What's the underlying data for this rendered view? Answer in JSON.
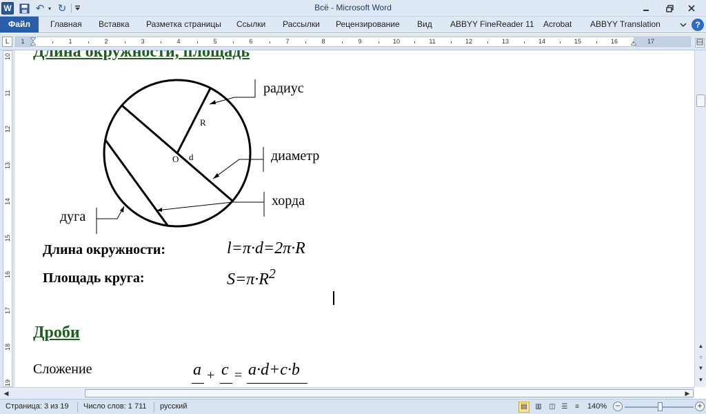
{
  "app": {
    "logo": "W",
    "title": "Всё  -  Microsoft Word"
  },
  "quick_access": {
    "undo_glyph": "↶",
    "redo_glyph": "↻",
    "dropdown_glyph": "▾"
  },
  "ribbon": {
    "tabs": [
      {
        "label": "Файл"
      },
      {
        "label": "Главная"
      },
      {
        "label": "Вставка"
      },
      {
        "label": "Разметка страницы"
      },
      {
        "label": "Ссылки"
      },
      {
        "label": "Рассылки"
      },
      {
        "label": "Рецензирование"
      },
      {
        "label": "Вид"
      },
      {
        "label": "ABBYY FineReader 11"
      },
      {
        "label": "Acrobat"
      },
      {
        "label": "ABBYY Translation"
      }
    ],
    "help_label": "?"
  },
  "ruler": {
    "corner_glyph": "L",
    "horizontal_numbers": [
      "1",
      "1",
      "2",
      "3",
      "4",
      "5",
      "6",
      "7",
      "8",
      "9",
      "10",
      "11",
      "12",
      "13",
      "14",
      "15",
      "16",
      "17"
    ],
    "vertical_numbers": [
      "10",
      "11",
      "12",
      "13",
      "14",
      "15",
      "16",
      "17",
      "18",
      "19"
    ]
  },
  "document": {
    "heading_circle": "Длина окружности, площадь",
    "diagram_labels": {
      "radius": "радиус",
      "diameter": "диаметр",
      "chord": "хорда",
      "arc": "дуга",
      "r_letter": "R",
      "center": "O",
      "d_letter": "d"
    },
    "circumference_label": "Длина окружности:",
    "circumference_formula": "l=π·d=2π·R",
    "area_label": "Площадь  круга:",
    "area_formula": "S=π·R",
    "area_exponent": "2",
    "heading_fractions": "Дроби",
    "addition_label": "Сложение",
    "fraction": {
      "a": "a",
      "c": "c",
      "plus": "+",
      "equals": "=",
      "numerator": "a·d+c·b"
    }
  },
  "status": {
    "page": "Страница: 3 из 19",
    "words": "Число слов: 1 711",
    "language": "русский",
    "zoom": "140%",
    "zoom_level_percent": 140
  },
  "colors": {
    "heading": "#1d5f1d",
    "file_tab": "#2a5ea8",
    "chrome": "#dfe9f5"
  }
}
